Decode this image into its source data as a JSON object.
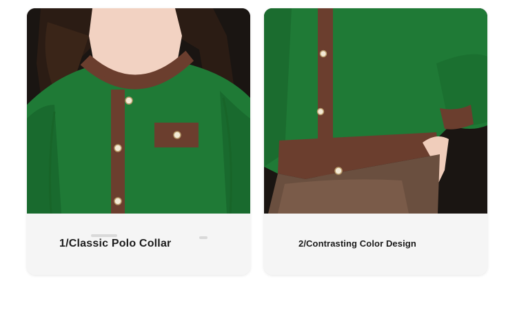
{
  "cards": [
    {
      "caption": "1/Classic Polo Collar",
      "image_subject": "green knit cardigan with brown round collar, pocket trim and pearl buttons"
    },
    {
      "caption": "2/Contrasting Color Design",
      "image_subject": "green knit cardigan with brown placket and ribbed hem worn over brown leather skirt"
    }
  ],
  "colors": {
    "sweater_green": "#1f7a36",
    "trim_brown": "#6b3e2e",
    "background_dark": "#1c1714",
    "caption_panel": "#f5f5f5",
    "skirt_leather": "#6a4f3f"
  }
}
